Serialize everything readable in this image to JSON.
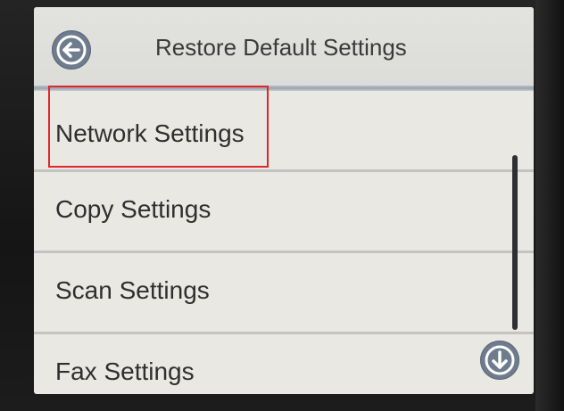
{
  "header": {
    "title": "Restore Default Settings",
    "back_icon": "arrow-left-icon"
  },
  "menu": {
    "items": [
      {
        "label": "Network Settings",
        "highlighted": true
      },
      {
        "label": "Copy Settings"
      },
      {
        "label": "Scan Settings"
      },
      {
        "label": "Fax Settings"
      }
    ]
  },
  "controls": {
    "scroll_down_icon": "arrow-down-icon"
  },
  "colors": {
    "screen_background": "#e9e8e3",
    "button_fill": "#6e7c8d",
    "highlight_border": "#e0262a",
    "text": "#2f2f2f"
  }
}
